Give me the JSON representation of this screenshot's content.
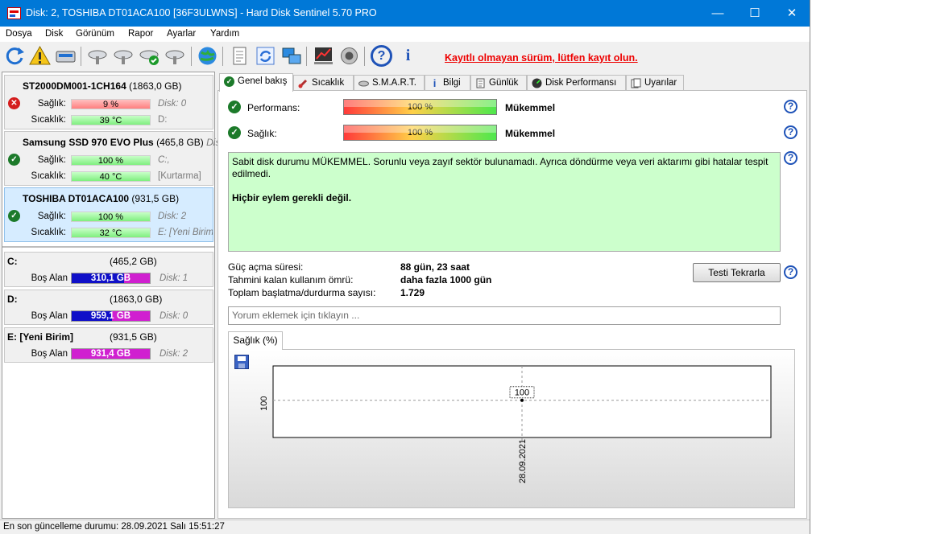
{
  "window": {
    "title": "Disk: 2, TOSHIBA DT01ACA100 [36F3ULWNS]  -  Hard Disk Sentinel 5.70 PRO",
    "minimize": "—",
    "maximize": "☐",
    "close": "✕"
  },
  "menu": [
    "Dosya",
    "Disk",
    "Görünüm",
    "Rapor",
    "Ayarlar",
    "Yardım"
  ],
  "toolbar": {
    "icons": [
      "refresh-icon",
      "warning-icon",
      "disk-icon",
      "disk-tool-1-icon",
      "disk-tool-2-icon",
      "disk-check-icon",
      "disk-tool-3-icon",
      "globe-icon",
      "report-icon",
      "sync-icon",
      "network-icon",
      "chart-icon",
      "speaker-icon",
      "help-icon",
      "info-icon"
    ],
    "help_glyph": "?",
    "info_glyph": "i",
    "notice": "Kayıtlı olmayan sürüm, lütfen kayıt olun."
  },
  "disks": [
    {
      "name": "ST2000DM001-1CH164",
      "size": "(1863,0 GB)",
      "status": "bad",
      "status_glyph": "✕",
      "health_label": "Sağlık:",
      "health": "9 %",
      "health_value": 9,
      "health_color": "red",
      "temp_label": "Sıcaklık:",
      "temp": "39 °C",
      "extra1": "Disk: 0",
      "extra2": "D:"
    },
    {
      "name": "Samsung SSD 970 EVO Plus",
      "size": "(465,8 GB)",
      "name_extra": "Disk:",
      "status": "ok",
      "status_glyph": "✓",
      "health_label": "Sağlık:",
      "health": "100 %",
      "health_value": 100,
      "health_color": "green",
      "temp_label": "Sıcaklık:",
      "temp": "40 °C",
      "extra1": "C:,",
      "extra2": "[Kurtarma]"
    },
    {
      "name": "TOSHIBA DT01ACA100",
      "size": "(931,5 GB)",
      "status": "ok",
      "status_glyph": "✓",
      "health_label": "Sağlık:",
      "health": "100 %",
      "health_value": 100,
      "health_color": "green",
      "temp_label": "Sıcaklık:",
      "temp": "32 °C",
      "extra1": "Disk: 2",
      "extra2": "E: [Yeni Birim]"
    }
  ],
  "volumes": [
    {
      "name": "C:",
      "size": "(465,2 GB)",
      "free_label": "Boş Alan",
      "free": "310,1 GB",
      "free_fraction": 0.667,
      "color": "#1010c8",
      "color2": "#d020d0",
      "disk": "Disk: 1"
    },
    {
      "name": "D:",
      "size": "(1863,0 GB)",
      "free_label": "Boş Alan",
      "free": "959,1 GB",
      "free_fraction": 0.515,
      "color": "#1010c8",
      "color2": "#d020d0",
      "disk": "Disk: 0"
    },
    {
      "name": "E: [Yeni Birim]",
      "size": "(931,5 GB)",
      "free_label": "Boş Alan",
      "free": "931,4 GB",
      "free_fraction": 1.0,
      "color": "#d020d0",
      "color2": "#d020d0",
      "disk": "Disk: 2"
    }
  ],
  "tabs": [
    {
      "label": "Genel bakış",
      "icon": "check-icon"
    },
    {
      "label": "Sıcaklık",
      "icon": "thermometer-icon"
    },
    {
      "label": "S.M.A.R.T.",
      "icon": "smart-icon"
    },
    {
      "label": "Bilgi",
      "icon": "info-icon"
    },
    {
      "label": "Günlük",
      "icon": "log-icon"
    },
    {
      "label": "Disk Performansı",
      "icon": "gauge-icon"
    },
    {
      "label": "Uyarılar",
      "icon": "alerts-icon"
    }
  ],
  "overview": {
    "performance_label": "Performans:",
    "performance_value": "100 %",
    "performance_rating": "Mükemmel",
    "health_label": "Sağlık:",
    "health_value": "100 %",
    "health_rating": "Mükemmel",
    "ok_glyph": "✓",
    "help_glyph": "?",
    "status_text": "Sabit disk durumu MÜKEMMEL. Sorunlu veya zayıf sektör bulunamadı. Ayrıca döndürme veya veri aktarımı gibi hatalar tespit edilmedi.",
    "status_action": "Hiçbir eylem gerekli değil.",
    "power_on_label": "Güç açma süresi:",
    "power_on_value": "88 gün, 23 saat",
    "remaining_label": "Tahmini kalan kullanım ömrü:",
    "remaining_value": "daha fazla 1000 gün",
    "startstop_label": "Toplam başlatma/durdurma sayısı:",
    "startstop_value": "1.729",
    "retest_button": "Testi Tekrarla",
    "comment_placeholder": "Yorum eklemek için tıklayın ..."
  },
  "chart_tab": "Sağlık (%)",
  "chart_data": {
    "type": "line",
    "title": "",
    "ylabel": "",
    "xlabel": "",
    "x": [
      "28.09.2021"
    ],
    "series": [
      {
        "values": [
          100
        ]
      }
    ],
    "y_tick_label": "100",
    "point_label": "100",
    "grid": true
  },
  "statusbar": "En son güncelleme durumu: 28.09.2021 Salı 15:51:27"
}
